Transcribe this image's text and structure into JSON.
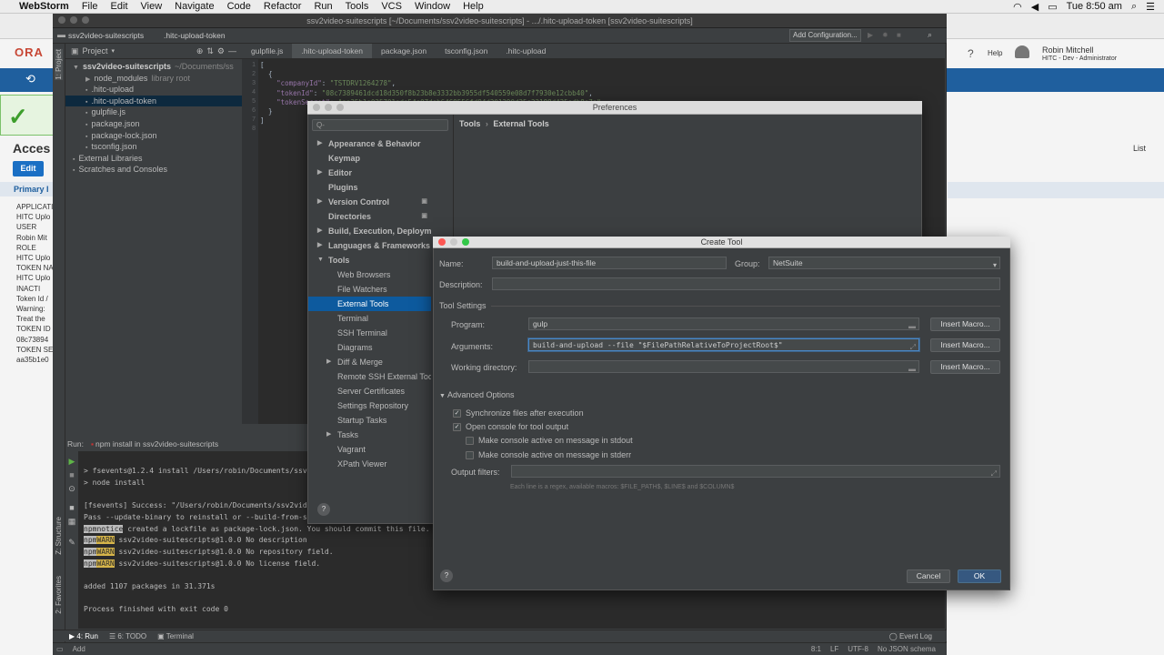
{
  "menubar": {
    "app": "WebStorm",
    "items": [
      "File",
      "Edit",
      "View",
      "Navigate",
      "Code",
      "Refactor",
      "Run",
      "Tools",
      "VCS",
      "Window",
      "Help"
    ],
    "time": "Tue 8:50 am"
  },
  "browser": {
    "logo": "ORA",
    "user_name": "Robin Mitchell",
    "user_role": "HITC - Dev - Administrator",
    "help": "Help",
    "edit": "Edit",
    "access_title": "Acces",
    "list": "List",
    "primary": "Primary I",
    "left_lines": [
      "APPLICATI",
      "HITC Uplo",
      "USER",
      "Robin Mit",
      "ROLE",
      "HITC Uplo",
      "TOKEN NA",
      "HITC Uplo",
      "INACTI",
      "Token Id /",
      "Warning:",
      "Treat the",
      "TOKEN ID",
      "08c73894",
      "TOKEN SE",
      "aa35b1e0"
    ]
  },
  "ide": {
    "title": "ssv2video-suitescripts [~/Documents/ssv2video-suitescripts] - .../.hitc-upload-token [ssv2video-suitescripts]",
    "breadcrumb_project": "ssv2video-suitescripts",
    "breadcrumb_file": ".hitc-upload-token",
    "add_config": "Add Configuration...",
    "project_label": "Project",
    "tree": [
      {
        "label": "ssv2video-suitescripts",
        "suffix": "~/Documents/ss",
        "indent": 0
      },
      {
        "label": "node_modules",
        "suffix": "library root",
        "indent": 1
      },
      {
        "label": ".hitc-upload",
        "suffix": "",
        "indent": 1
      },
      {
        "label": ".hitc-upload-token",
        "suffix": "",
        "indent": 1
      },
      {
        "label": "gulpfile.js",
        "suffix": "",
        "indent": 1
      },
      {
        "label": "package.json",
        "suffix": "",
        "indent": 1
      },
      {
        "label": "package-lock.json",
        "suffix": "",
        "indent": 1
      },
      {
        "label": "tsconfig.json",
        "suffix": "",
        "indent": 1
      },
      {
        "label": "External Libraries",
        "suffix": "",
        "indent": 0
      },
      {
        "label": "Scratches and Consoles",
        "suffix": "",
        "indent": 0
      }
    ],
    "tabs": [
      "gulpfile.js",
      ".hitc-upload-token",
      "package.json",
      "tsconfig.json",
      ".hitc-upload"
    ],
    "active_tab": 1,
    "code": {
      "line1": "[",
      "line2": "  {",
      "key1": "\"companyId\"",
      "val1": "\"TSTDRV1264278\"",
      "key2": "\"tokenId\"",
      "val2": "\"08c7389461dcd18d350f8b23b8e3332bb3955df540559e08d7f7930e12cbb40\"",
      "key3": "\"tokenSecret\"",
      "val3": "\"aa35b1e025701ede54e07deb6469556fd94d201290d25e22188d425edb8e7e\"",
      "line7": "  }",
      "line8": "]"
    },
    "run_label": "Run:",
    "run_tab": "npm install in ssv2video-suitescripts",
    "console": {
      "l1": "> fsevents@1.2.4 install /Users/robin/Documents/ssv2video",
      "l2": "> node install",
      "l3": "[fsevents] Success: \"/Users/robin/Documents/ssv2video",
      "l4": "Pass --update-binary to reinstall or --build-from-sou",
      "npm": "npm",
      "notice": "notice",
      "l5": "created a lockfile as package-lock.json. You should commit this file.",
      "warn": "WARN",
      "l6": "ssv2video-suitescripts@1.0.0 No description",
      "l7": "ssv2video-suitescripts@1.0.0 No repository field.",
      "l8": "ssv2video-suitescripts@1.0.0 No license field.",
      "l9": "added 1107 packages in 31.371s",
      "l10": "Process finished with exit code 0"
    },
    "bottom_tabs": [
      "4: Run",
      "6: TODO",
      "Terminal"
    ],
    "event_log": "Event Log",
    "status_left": "Add",
    "status_right": [
      "8:1",
      "LF",
      "UTF-8",
      "No JSON schema"
    ],
    "side_labels": [
      "1: Project",
      "Z: Structure",
      "2: Favorites"
    ]
  },
  "prefs": {
    "title": "Preferences",
    "search_placeholder": "Q-",
    "breadcrumb": [
      "Tools",
      "External Tools"
    ],
    "items": [
      {
        "label": "Appearance & Behavior",
        "level": 0,
        "arrow": "▶",
        "bold": true
      },
      {
        "label": "Keymap",
        "level": 0,
        "arrow": "",
        "bold": true
      },
      {
        "label": "Editor",
        "level": 0,
        "arrow": "▶",
        "bold": true
      },
      {
        "label": "Plugins",
        "level": 0,
        "arrow": "",
        "bold": true
      },
      {
        "label": "Version Control",
        "level": 0,
        "arrow": "▶",
        "bold": true
      },
      {
        "label": "Directories",
        "level": 0,
        "arrow": "",
        "bold": true
      },
      {
        "label": "Build, Execution, Deployment",
        "level": 0,
        "arrow": "▶",
        "bold": true
      },
      {
        "label": "Languages & Frameworks",
        "level": 0,
        "arrow": "▶",
        "bold": true
      },
      {
        "label": "Tools",
        "level": 0,
        "arrow": "▼",
        "bold": true
      },
      {
        "label": "Web Browsers",
        "level": 1,
        "arrow": "",
        "bold": false
      },
      {
        "label": "File Watchers",
        "level": 1,
        "arrow": "",
        "bold": false
      },
      {
        "label": "External Tools",
        "level": 1,
        "arrow": "",
        "bold": false
      },
      {
        "label": "Terminal",
        "level": 1,
        "arrow": "",
        "bold": false
      },
      {
        "label": "SSH Terminal",
        "level": 1,
        "arrow": "",
        "bold": false
      },
      {
        "label": "Diagrams",
        "level": 1,
        "arrow": "",
        "bold": false
      },
      {
        "label": "Diff & Merge",
        "level": 1,
        "arrow": "▶",
        "bold": false
      },
      {
        "label": "Remote SSH External Tools",
        "level": 1,
        "arrow": "",
        "bold": false
      },
      {
        "label": "Server Certificates",
        "level": 1,
        "arrow": "",
        "bold": false
      },
      {
        "label": "Settings Repository",
        "level": 1,
        "arrow": "",
        "bold": false
      },
      {
        "label": "Startup Tasks",
        "level": 1,
        "arrow": "",
        "bold": false
      },
      {
        "label": "Tasks",
        "level": 1,
        "arrow": "▶",
        "bold": false
      },
      {
        "label": "Vagrant",
        "level": 1,
        "arrow": "",
        "bold": false
      },
      {
        "label": "XPath Viewer",
        "level": 1,
        "arrow": "",
        "bold": false
      }
    ],
    "selected": 11,
    "help": "?"
  },
  "create_tool": {
    "title": "Create Tool",
    "name_label": "Name:",
    "name_value": "build-and-upload-just-this-file",
    "group_label": "Group:",
    "group_value": "NetSuite",
    "description_label": "Description:",
    "description_value": "",
    "tool_settings": "Tool Settings",
    "program_label": "Program:",
    "program_value": "gulp",
    "arguments_label": "Arguments:",
    "arguments_value": "build-and-upload --file \"$FilePathRelativeToProjectRoot$\"",
    "working_dir_label": "Working directory:",
    "working_dir_value": "",
    "insert_macro": "Insert Macro...",
    "advanced": "Advanced Options",
    "sync_label": "Synchronize files after execution",
    "sync_checked": true,
    "console_label": "Open console for tool output",
    "console_checked": true,
    "stdout_label": "Make console active on message in stdout",
    "stdout_checked": false,
    "stderr_label": "Make console active on message in stderr",
    "stderr_checked": false,
    "output_filters_label": "Output filters:",
    "output_filters_value": "",
    "hint": "Each line is a regex, available macros: $FILE_PATH$, $LINE$ and $COLUMN$",
    "cancel": "Cancel",
    "ok": "OK",
    "help": "?"
  }
}
